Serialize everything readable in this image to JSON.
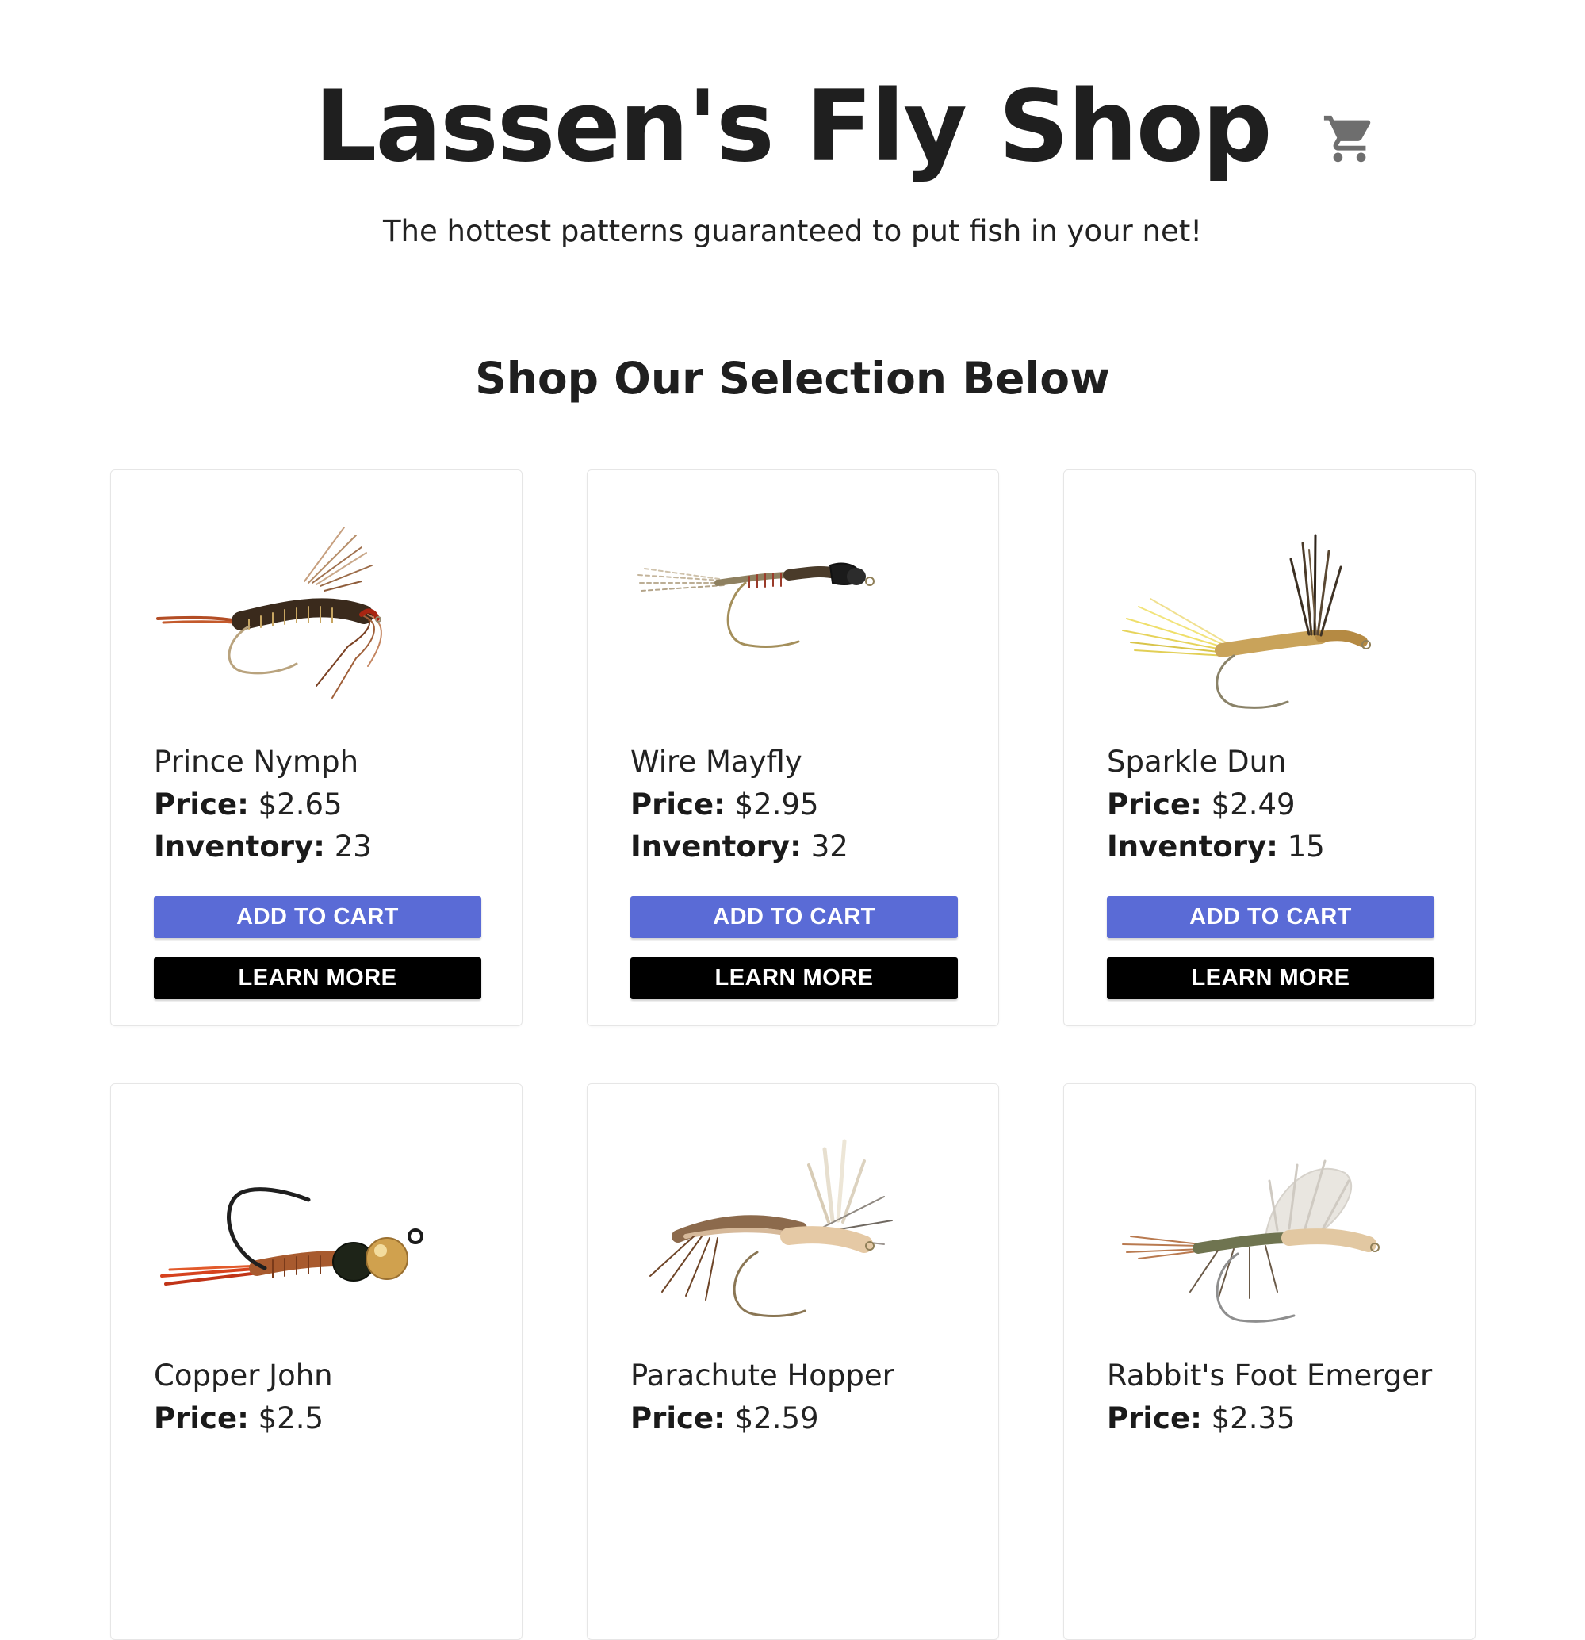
{
  "header": {
    "title": "Lassen's Fly Shop",
    "tagline": "The hottest patterns guaranteed to put fish in your net!",
    "cart_icon": "shopping-cart-icon"
  },
  "main": {
    "section_title": "Shop Our Selection Below",
    "price_label": "Price:",
    "inventory_label": "Inventory:",
    "add_to_cart_label": "ADD TO CART",
    "learn_more_label": "LEARN MORE",
    "products": [
      {
        "name": "Prince Nymph",
        "price": "$2.65",
        "inventory": "23",
        "image": "prince-nymph-fly-image"
      },
      {
        "name": "Wire Mayfly",
        "price": "$2.95",
        "inventory": "32",
        "image": "wire-mayfly-fly-image"
      },
      {
        "name": "Sparkle Dun",
        "price": "$2.49",
        "inventory": "15",
        "image": "sparkle-dun-fly-image"
      },
      {
        "name": "Copper John",
        "price": "$2.5",
        "inventory": "",
        "image": "copper-john-fly-image"
      },
      {
        "name": "Parachute Hopper",
        "price": "$2.59",
        "inventory": "",
        "image": "parachute-hopper-fly-image"
      },
      {
        "name": "Rabbit's Foot Emerger",
        "price": "$2.35",
        "inventory": "",
        "image": "rabbits-foot-emerger-fly-image"
      }
    ]
  },
  "colors": {
    "add_to_cart_button": "#5a6bd6",
    "learn_more_button": "#000000",
    "cart_icon": "#6e6e6e",
    "text": "#222222"
  }
}
